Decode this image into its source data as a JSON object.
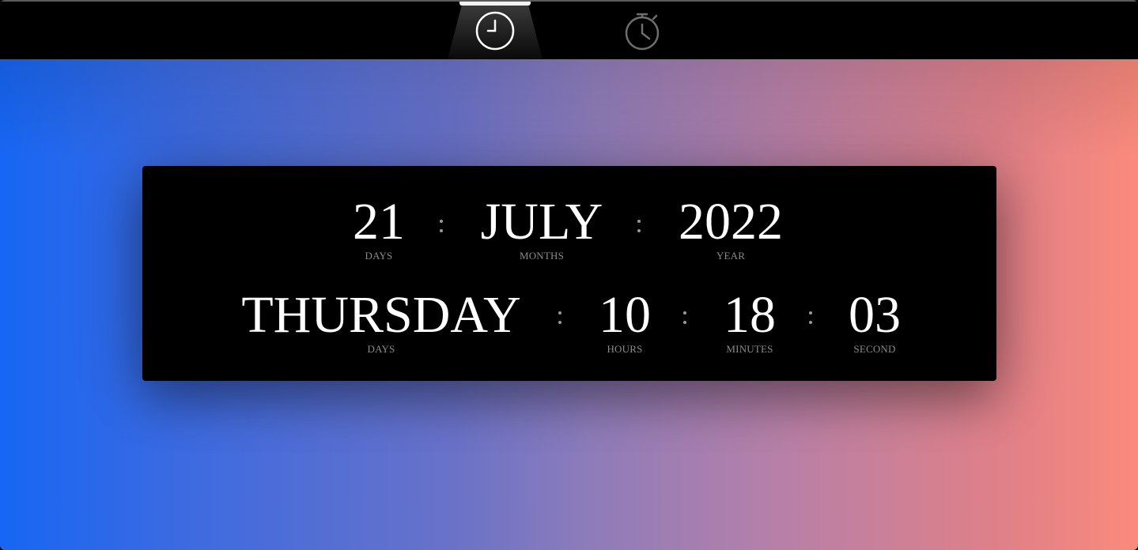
{
  "nav": {
    "tabs": [
      {
        "id": "clock",
        "icon": "clock-icon",
        "active": true
      },
      {
        "id": "stopwatch",
        "icon": "stopwatch-icon",
        "active": false
      }
    ]
  },
  "clock": {
    "date": {
      "day": "21",
      "day_label": "DAYS",
      "month": "JULY",
      "month_label": "MONTHS",
      "year": "2022",
      "year_label": "YEAR"
    },
    "time": {
      "weekday": "THURSDAY",
      "weekday_label": "DAYS",
      "hours": "10",
      "hours_label": "HOURS",
      "minutes": "18",
      "minutes_label": "MINUTES",
      "seconds": "03",
      "seconds_label": "SECOND"
    }
  },
  "colors": {
    "gradient_start": "#1766f4",
    "gradient_end": "#fb8a7c",
    "card_background": "#000000",
    "value_text": "#ffffff",
    "label_text": "#8a8a8a"
  }
}
